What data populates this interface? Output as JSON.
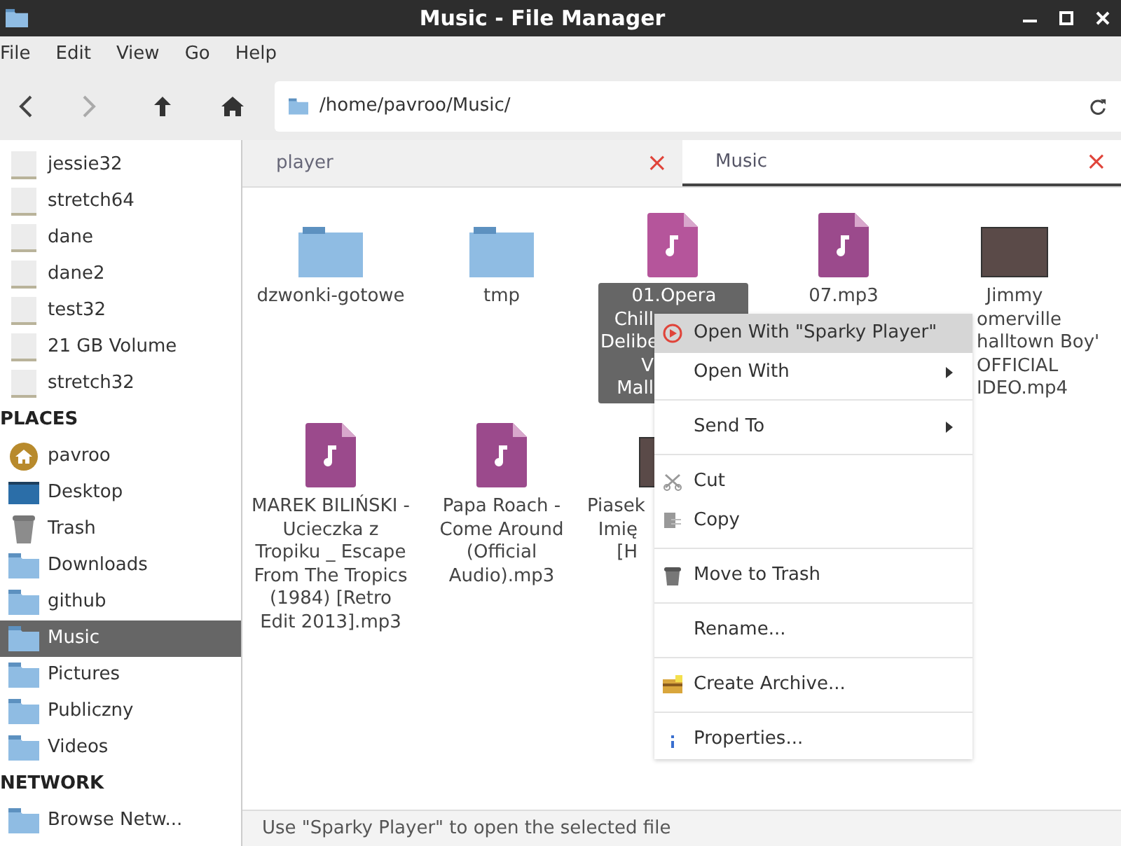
{
  "window": {
    "title": "Music - File Manager"
  },
  "menubar": [
    "File",
    "Edit",
    "View",
    "Go",
    "Help"
  ],
  "location": {
    "path": "/home/pavroo/Music/"
  },
  "sidebar": {
    "sections": [
      {
        "items": [
          {
            "label": "jessie32",
            "kind": "drive",
            "selected": false
          },
          {
            "label": "stretch64",
            "kind": "drive",
            "selected": false
          },
          {
            "label": "dane",
            "kind": "drive",
            "selected": false
          },
          {
            "label": "dane2",
            "kind": "drive",
            "selected": false
          },
          {
            "label": "test32",
            "kind": "drive",
            "selected": false
          },
          {
            "label": "21 GB Volume",
            "kind": "drive",
            "selected": false
          },
          {
            "label": "stretch32",
            "kind": "drive",
            "selected": false
          }
        ]
      },
      {
        "heading": "PLACES",
        "items": [
          {
            "label": "pavroo",
            "kind": "home",
            "selected": false
          },
          {
            "label": "Desktop",
            "kind": "desktop",
            "selected": false
          },
          {
            "label": "Trash",
            "kind": "trash",
            "selected": false
          },
          {
            "label": "Downloads",
            "kind": "folder",
            "selected": false
          },
          {
            "label": "github",
            "kind": "folder",
            "selected": false
          },
          {
            "label": "Music",
            "kind": "folder",
            "selected": true
          },
          {
            "label": "Pictures",
            "kind": "folder",
            "selected": false
          },
          {
            "label": "Publiczny",
            "kind": "folder",
            "selected": false
          },
          {
            "label": "Videos",
            "kind": "folder",
            "selected": false
          }
        ]
      },
      {
        "heading": "NETWORK",
        "items": [
          {
            "label": "Browse Netw...",
            "kind": "folder",
            "selected": false
          }
        ]
      }
    ]
  },
  "tabs": [
    {
      "label": "player",
      "selected": false,
      "close": "×"
    },
    {
      "label": "Music",
      "selected": true,
      "close": "×"
    }
  ],
  "files": [
    {
      "kind": "folder",
      "label": [
        "dzwonki-gotowe"
      ],
      "selected": false
    },
    {
      "kind": "folder",
      "label": [
        "tmp"
      ],
      "selected": false
    },
    {
      "kind": "audio",
      "label": [
        "01.Opera",
        "Chill",
        "Delibe",
        "V",
        "Mall"
      ],
      "selected": true
    },
    {
      "kind": "audio",
      "label": [
        "07.mp3"
      ],
      "selected": false
    },
    {
      "kind": "video",
      "label": [
        "Jimmy",
        "omerville",
        "halltown Boy'",
        "OFFICIAL",
        "IDEO.mp4"
      ],
      "selected": false
    },
    {
      "kind": "audio",
      "label": [
        "MAREK BILIŃSKI - Ucieczka z Tropiku _ Escape From The Tropics (1984) [Retro Edit 2013].mp3"
      ],
      "selected": false
    },
    {
      "kind": "audio",
      "label": [
        "Papa Roach - Come Around (Official Audio).mp3"
      ],
      "selected": false
    },
    {
      "kind": "video",
      "label": [
        "Piasek",
        "Imię",
        "[H"
      ],
      "selected": false
    }
  ],
  "context_menu": [
    {
      "kind": "item",
      "label": "Open With \"Sparky Player\"",
      "selected": true,
      "submenu": false
    },
    {
      "kind": "item",
      "label": "Open With",
      "selected": false,
      "submenu": true
    },
    {
      "kind": "separator"
    },
    {
      "kind": "item",
      "label": "Send To",
      "selected": false,
      "submenu": true
    },
    {
      "kind": "separator"
    },
    {
      "kind": "item",
      "label": "Cut",
      "selected": false,
      "submenu": false
    },
    {
      "kind": "item",
      "label": "Copy",
      "selected": false,
      "submenu": false
    },
    {
      "kind": "separator"
    },
    {
      "kind": "item",
      "label": "Move to Trash",
      "selected": false,
      "submenu": false
    },
    {
      "kind": "separator"
    },
    {
      "kind": "item",
      "label": "Rename...",
      "selected": false,
      "submenu": false
    },
    {
      "kind": "separator"
    },
    {
      "kind": "item",
      "label": "Create Archive...",
      "selected": false,
      "submenu": false
    },
    {
      "kind": "separator"
    },
    {
      "kind": "item",
      "label": "Properties...",
      "selected": false,
      "submenu": false
    }
  ],
  "status_bar": "Use \"Sparky Player\" to open the selected file"
}
